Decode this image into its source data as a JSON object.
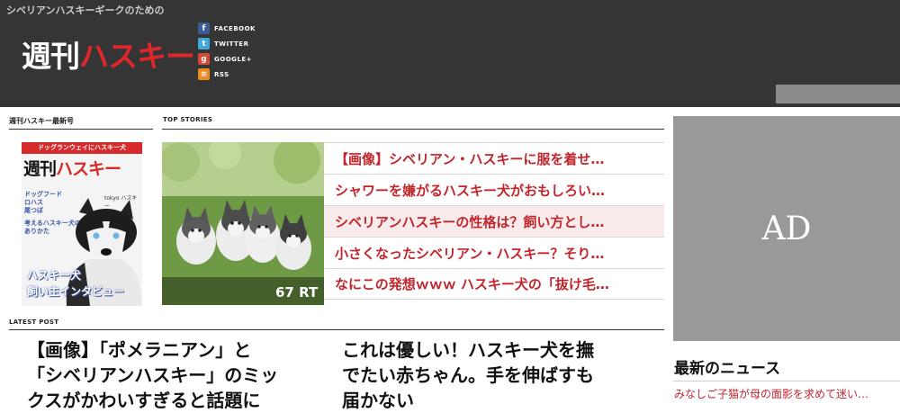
{
  "header": {
    "tagline": "シベリアンハスキーギークのための",
    "logo_white": "週刊",
    "logo_red": "ハスキー",
    "social": [
      {
        "label": "FACEBOOK",
        "icon": "facebook-icon",
        "glyph": "f"
      },
      {
        "label": "TWITTER",
        "icon": "twitter-icon",
        "glyph": "t"
      },
      {
        "label": "GOOGLE+",
        "icon": "google-plus-icon",
        "glyph": "g"
      },
      {
        "label": "RSS",
        "icon": "rss-icon",
        "glyph": "≋"
      }
    ]
  },
  "issue": {
    "heading": "週刊ハスキー最新号",
    "cover_bar": "ドッグランウェイにハスキー犬",
    "cover_title_black": "週刊",
    "cover_title_red": "ハスキー",
    "cover_brand": "tokyo ハスキー",
    "cover_lines": [
      "ドッグフード",
      "ロハス",
      "尾つぼ"
    ],
    "cover_lines2": [
      "考えるハスキー犬の",
      "ありかた"
    ],
    "cover_interview_1": "ハスキー犬",
    "cover_interview_2": "飼い主インタビュー"
  },
  "top_stories": {
    "heading": "TOP STORIES",
    "rt_count": "67 RT",
    "items": [
      "【画像】シベリアン・ハスキーに服を着せ…",
      "シャワーを嫌がるハスキー犬がおもしろい…",
      "シベリアンハスキーの性格は？飼い方とし…",
      "小さくなったシベリアン・ハスキー？そり…",
      "なにこの発想ｗｗｗ ハスキー犬の「抜け毛…"
    ]
  },
  "latest": {
    "heading": "LATEST POST",
    "article1_lines": [
      "【画像】「ポメラニアン」と",
      "「シベリアンハスキー」のミッ",
      "クスがかわいすぎると話題に"
    ],
    "article2_lines": [
      "これは優しい！ハスキー犬を撫",
      "でたい赤ちゃん。手を伸ばすも",
      "届かない"
    ]
  },
  "sidebar": {
    "ad_label": "AD",
    "news_heading": "最新のニュース",
    "news_item": "みなしご子猫が母の面影を求めて迷い…"
  },
  "colors": {
    "header_bg": "#353535",
    "accent_red": "#c1262d",
    "ad_bg": "#999999"
  }
}
